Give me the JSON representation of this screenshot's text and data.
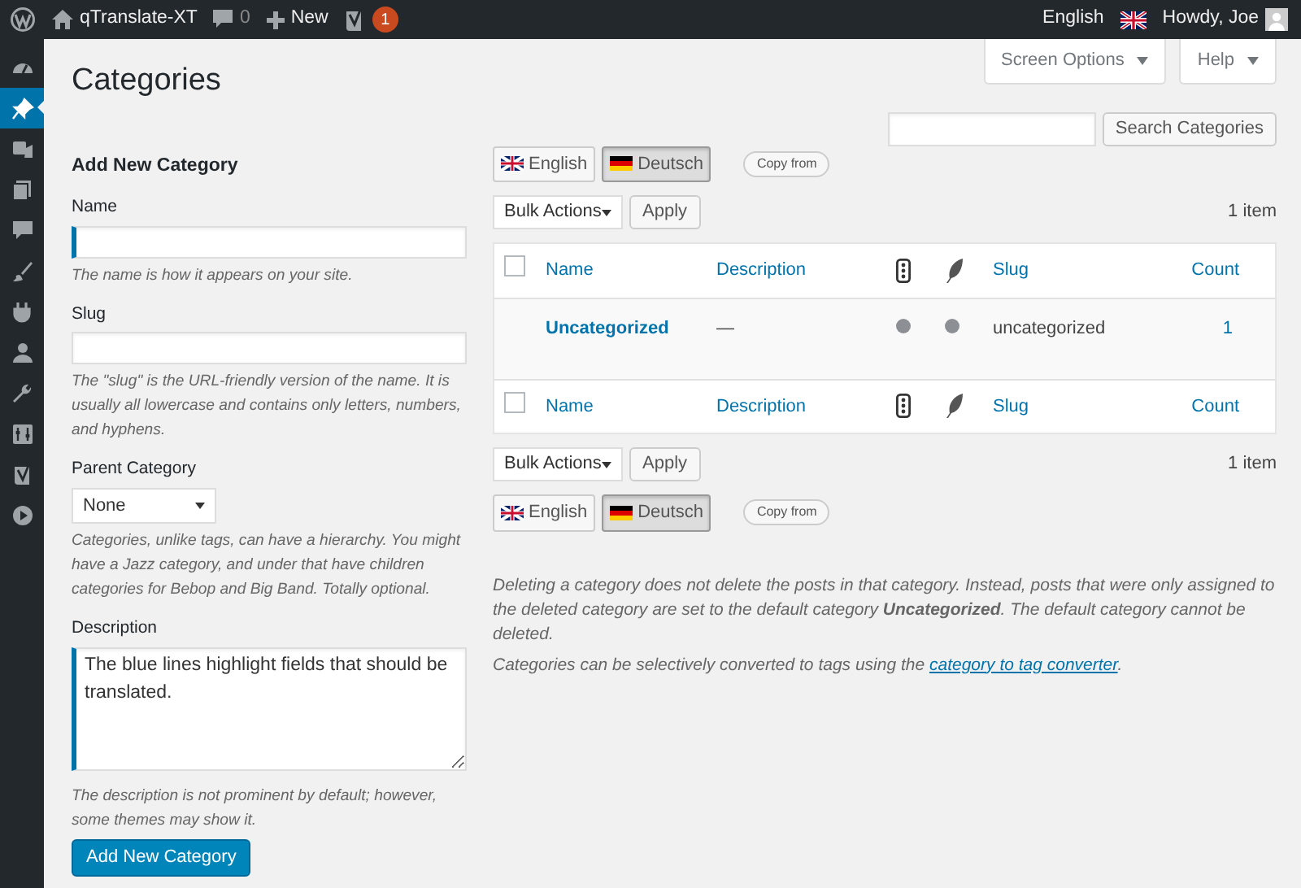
{
  "admin_bar": {
    "site_name": "qTranslate-XT",
    "comments_count": "0",
    "new_label": "New",
    "notification_count": "1",
    "language": "English",
    "greeting": "Howdy, Joe"
  },
  "sidebar": {
    "items": [
      {
        "kind": "dashboard",
        "selected": false
      },
      {
        "kind": "pin",
        "selected": true
      },
      {
        "kind": "media",
        "selected": false
      },
      {
        "kind": "pages",
        "selected": false
      },
      {
        "kind": "comments",
        "selected": false
      },
      {
        "kind": "brush",
        "selected": false
      },
      {
        "kind": "plug",
        "selected": false
      },
      {
        "kind": "user",
        "selected": false
      },
      {
        "kind": "wrench",
        "selected": false
      },
      {
        "kind": "settings",
        "selected": false
      },
      {
        "kind": "yoast",
        "selected": false
      },
      {
        "kind": "play",
        "selected": false
      }
    ]
  },
  "page_title": "Categories",
  "screen_meta": {
    "screen_options": "Screen Options",
    "help": "Help"
  },
  "search": {
    "button": "Search Categories"
  },
  "add_form": {
    "heading": "Add New Category",
    "fields": [
      {
        "kind": "text",
        "label": "Name",
        "translatable": true,
        "hint": "The name is how it appears on your site."
      },
      {
        "kind": "text",
        "label": "Slug",
        "translatable": false,
        "hint": "The \"slug\" is the URL-friendly version of the name. It is usually all lowercase and contains only letters, numbers, and hyphens."
      },
      {
        "kind": "select",
        "label": "Parent Category",
        "value": "None",
        "translatable": false,
        "hint": "Categories, unlike tags, can have a hierarchy. You might have a Jazz category, and under that have children categories for Bebop and Big Band. Totally optional."
      },
      {
        "kind": "textarea",
        "label": "Description",
        "value": "The blue lines highlight fields that should be translated.",
        "translatable": true,
        "hint": "The description is not prominent by default; however, some themes may show it."
      }
    ],
    "submit": "Add New Category"
  },
  "language_switchers": [
    {
      "languages": [
        {
          "label": "English",
          "kind": "uk",
          "selected": false
        },
        {
          "label": "Deutsch",
          "kind": "de",
          "selected": true
        }
      ],
      "copy_from": "Copy from"
    },
    {
      "languages": [
        {
          "label": "English",
          "kind": "uk",
          "selected": false
        },
        {
          "label": "Deutsch",
          "kind": "de",
          "selected": true
        }
      ],
      "copy_from": "Copy from"
    }
  ],
  "tablenavs": [
    {
      "bulk_actions": "Bulk Actions",
      "apply": "Apply",
      "count": "1 item"
    },
    {
      "bulk_actions": "Bulk Actions",
      "apply": "Apply",
      "count": "1 item"
    }
  ],
  "table": {
    "columns": [
      {
        "kind": "checkbox",
        "checked": false
      },
      {
        "kind": "text",
        "label": "Name"
      },
      {
        "kind": "text",
        "label": "Description"
      },
      {
        "kind": "dots-icon"
      },
      {
        "kind": "feather-icon"
      },
      {
        "kind": "text",
        "label": "Slug"
      },
      {
        "kind": "text",
        "label": "Count"
      }
    ],
    "footer_columns": [
      {
        "kind": "checkbox",
        "checked": false
      },
      {
        "kind": "text",
        "label": "Name"
      },
      {
        "kind": "text",
        "label": "Description"
      },
      {
        "kind": "dots-icon"
      },
      {
        "kind": "feather-icon"
      },
      {
        "kind": "text",
        "label": "Slug"
      },
      {
        "kind": "text",
        "label": "Count"
      }
    ],
    "rows": [
      {
        "name": "Uncategorized",
        "description": "—",
        "slug": "uncategorized",
        "count": "1"
      }
    ]
  },
  "notes": [
    {
      "text": "Deleting a category does not delete the posts in that category. Instead, posts that were only assigned to the deleted category are set to the default category **Uncategorized**. The default category cannot be deleted."
    },
    {
      "text": "Categories can be selectively converted to tags using the ",
      "link": "category to tag converter",
      "after": "."
    }
  ]
}
